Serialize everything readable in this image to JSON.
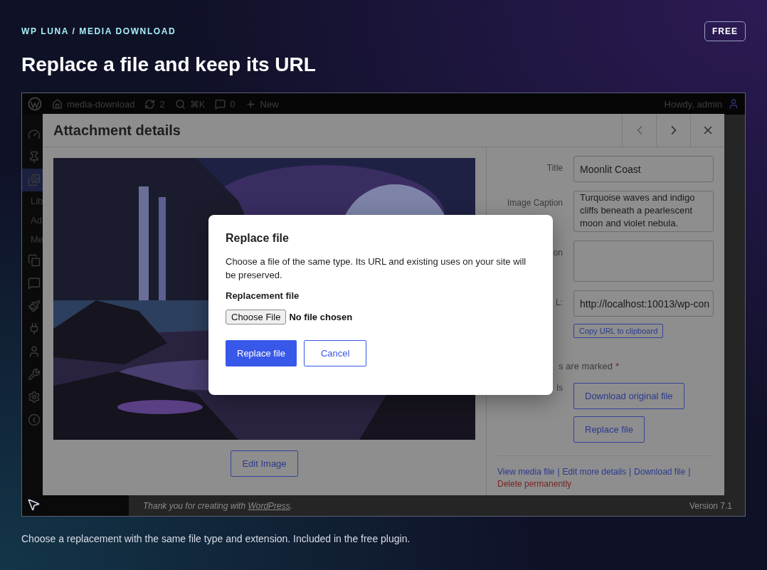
{
  "header": {
    "eyebrow": "WP LUNA / MEDIA DOWNLOAD",
    "badge": "FREE",
    "title": "Replace a file and keep its URL"
  },
  "admin_bar": {
    "site": "media-download",
    "updates": "2",
    "search": "⌘K",
    "comments": "0",
    "new": "New",
    "greeting": "Howdy, admin"
  },
  "sidebar": {
    "items": [
      {
        "selected": false
      },
      {
        "selected": false
      },
      {
        "selected": true
      },
      {
        "selected": false
      },
      {
        "selected": false
      },
      {
        "selected": false
      },
      {
        "selected": false
      },
      {
        "selected": false
      },
      {
        "selected": false
      },
      {
        "selected": false
      },
      {
        "selected": false
      }
    ],
    "submenu": [
      "Lib",
      "Ad",
      "Me"
    ]
  },
  "modal": {
    "title": "Attachment details",
    "image": {
      "kind": "picture"
    },
    "edit_button": "Edit Image",
    "fields": [
      {
        "kind": "input",
        "label": "Title",
        "value": "Moonlit Coast"
      },
      {
        "kind": "textarea",
        "label": "Image Caption",
        "value": "Turquoise waves and indigo cliffs beneath a pearlescent moon and violet nebula."
      },
      {
        "kind": "textarea",
        "label": "on"
      },
      {
        "kind": "input",
        "label": "L:",
        "value": "http://localhost:10013/wp-con"
      }
    ],
    "copy_button": "Copy URL to clipboard",
    "required_note": "s are marked",
    "required_mark": "*",
    "tools_label": "ls",
    "tools": [
      "Download original file",
      "Replace file"
    ],
    "links": [
      "View media file",
      "Edit more details",
      "Download file"
    ],
    "separator": "|",
    "delete_link": "Delete permanently"
  },
  "footer": {
    "thanks_before": "Thank you for creating with ",
    "link": "WordPress",
    "thanks_after": ".",
    "version": "Version 7.1"
  },
  "dialog": {
    "title": "Replace file",
    "text": "Choose a file of the same type. Its URL and existing uses on your site will be preserved.",
    "field_label": "Replacement file",
    "choose_button": "Choose File",
    "file_status": "No file chosen",
    "primary": "Replace file",
    "secondary": "Cancel"
  },
  "caption": "Choose a replacement with the same file type and extension. Included in the free plugin."
}
